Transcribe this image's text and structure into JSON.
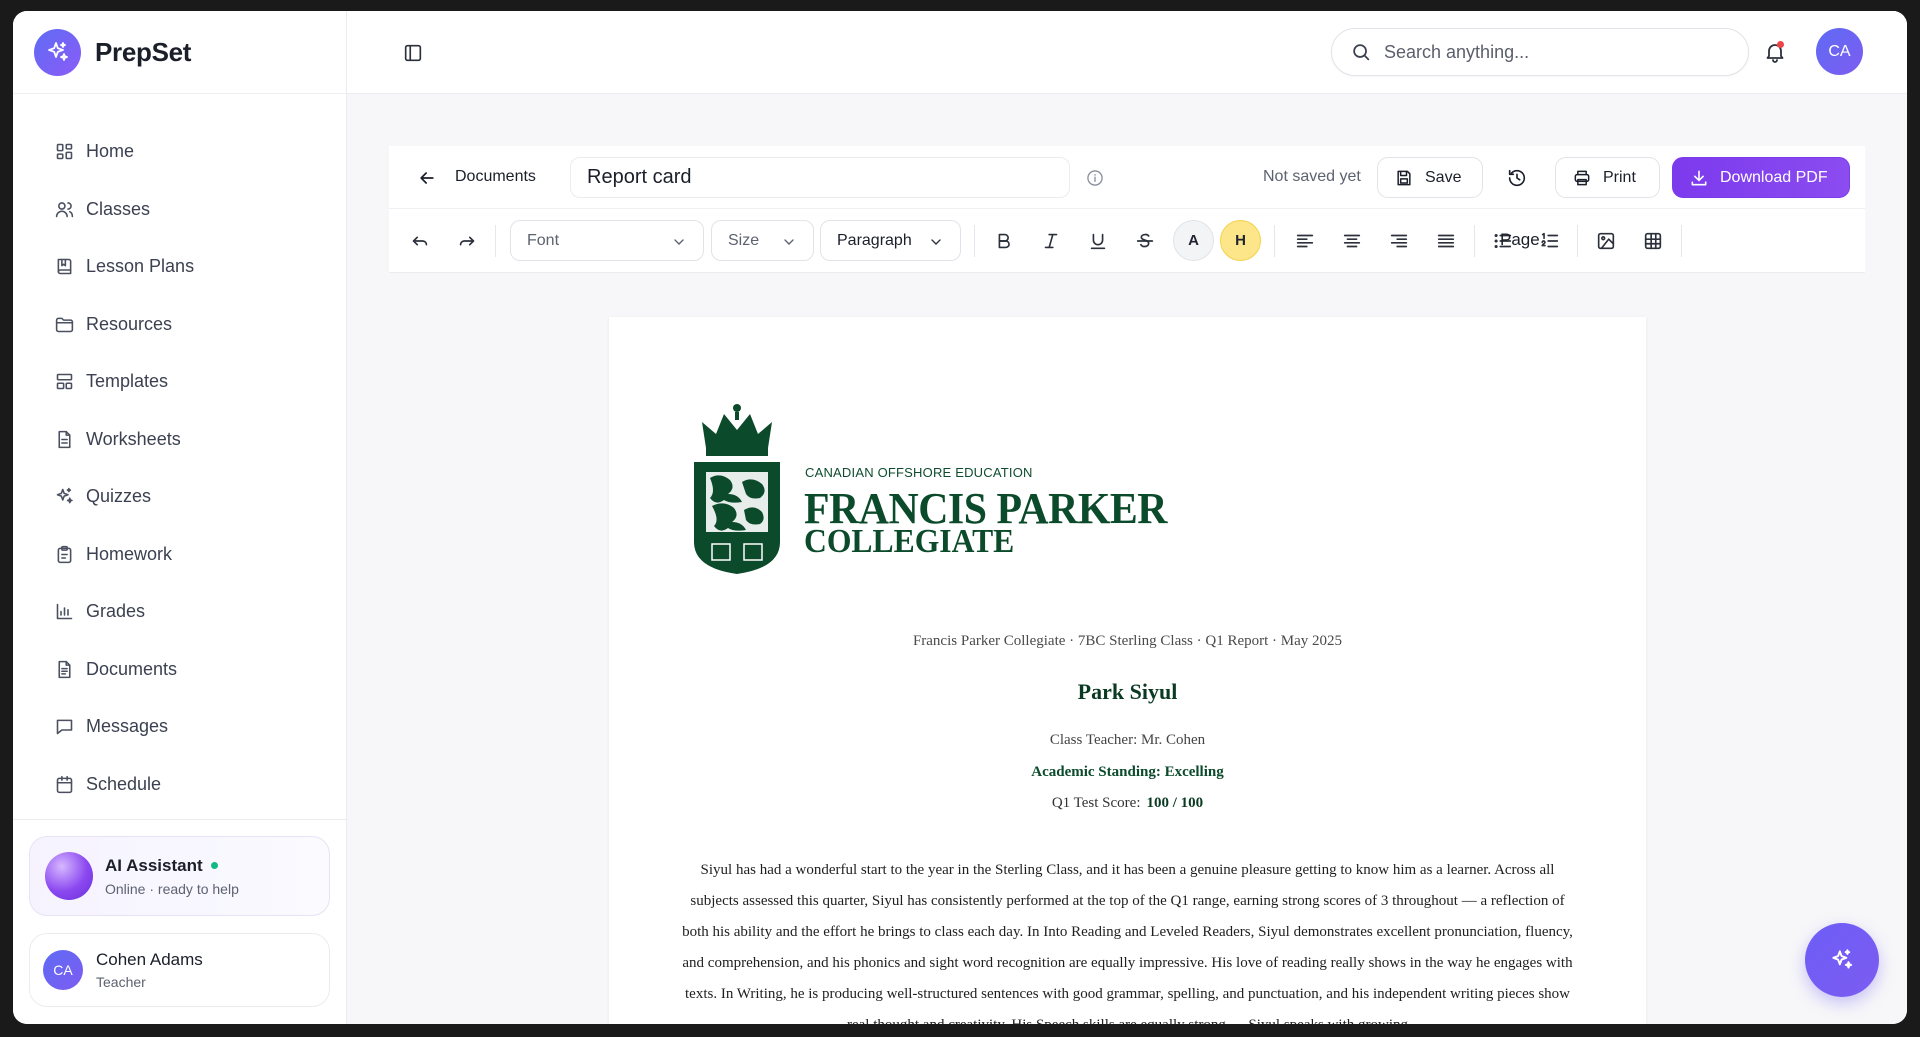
{
  "app": {
    "name": "PrepSet"
  },
  "sidebar": {
    "items": [
      {
        "label": "Home",
        "icon": "dashboard-icon"
      },
      {
        "label": "Classes",
        "icon": "users-icon"
      },
      {
        "label": "Lesson Plans",
        "icon": "book-icon"
      },
      {
        "label": "Resources",
        "icon": "folder-icon"
      },
      {
        "label": "Templates",
        "icon": "layout-icon"
      },
      {
        "label": "Worksheets",
        "icon": "file-icon"
      },
      {
        "label": "Quizzes",
        "icon": "sparkles-icon"
      },
      {
        "label": "Homework",
        "icon": "clipboard-icon"
      },
      {
        "label": "Grades",
        "icon": "bar-chart-icon"
      },
      {
        "label": "Documents",
        "icon": "document-icon"
      },
      {
        "label": "Messages",
        "icon": "message-icon"
      },
      {
        "label": "Schedule",
        "icon": "calendar-icon"
      }
    ],
    "assistant": {
      "title": "AI Assistant",
      "status": "Online · ready to help"
    },
    "user": {
      "initials": "CA",
      "name": "Cohen Adams",
      "role": "Teacher"
    }
  },
  "header": {
    "search_placeholder": "Search anything...",
    "avatar_initials": "CA"
  },
  "document": {
    "back_label": "Documents",
    "title": "Report card",
    "save_status": "Not saved yet",
    "save_label": "Save",
    "print_label": "Print",
    "download_label": "Download PDF"
  },
  "toolbar": {
    "font_placeholder": "Font",
    "size_placeholder": "Size",
    "paragraph_value": "Paragraph",
    "text_color_label": "A",
    "highlight_label": "H",
    "page_label": "Page"
  },
  "report": {
    "school_tagline": "CANADIAN OFFSHORE EDUCATION",
    "school_name_line1": "FRANCIS PARKER",
    "school_name_line2": "COLLEGIATE",
    "meta": "Francis Parker Collegiate  ·  7BC Sterling Class  ·  Q1 Report  ·  May 2025",
    "student_name": "Park Siyul",
    "teacher": "Class Teacher: Mr. Cohen",
    "standing": "Academic Standing: Excelling",
    "score_label": "Q1 Test Score:",
    "score_value": "100 / 100",
    "body": "Siyul has had a wonderful start to the year in the Sterling Class, and it has been a genuine pleasure getting to know him as a learner. Across all subjects assessed this quarter, Siyul has consistently performed at the top of the Q1 range, earning strong scores of 3 throughout — a reflection of both his ability and the effort he brings to class each day. In Into Reading and Leveled Readers, Siyul demonstrates excellent pronunciation, fluency, and comprehension, and his phonics and sight word recognition are equally impressive. His love of reading really shows in the way he engages with texts. In Writing, he is producing well-structured sentences with good grammar, spelling, and punctuation, and his independent writing pieces show real thought and creativity. His Speech skills are equally strong — Siyul speaks with growing"
  },
  "colors": {
    "accent": "#7c3aed",
    "brand": "#6366f1",
    "school_green": "#0b4a2a",
    "highlight": "#fde68a",
    "online": "#10b981"
  }
}
